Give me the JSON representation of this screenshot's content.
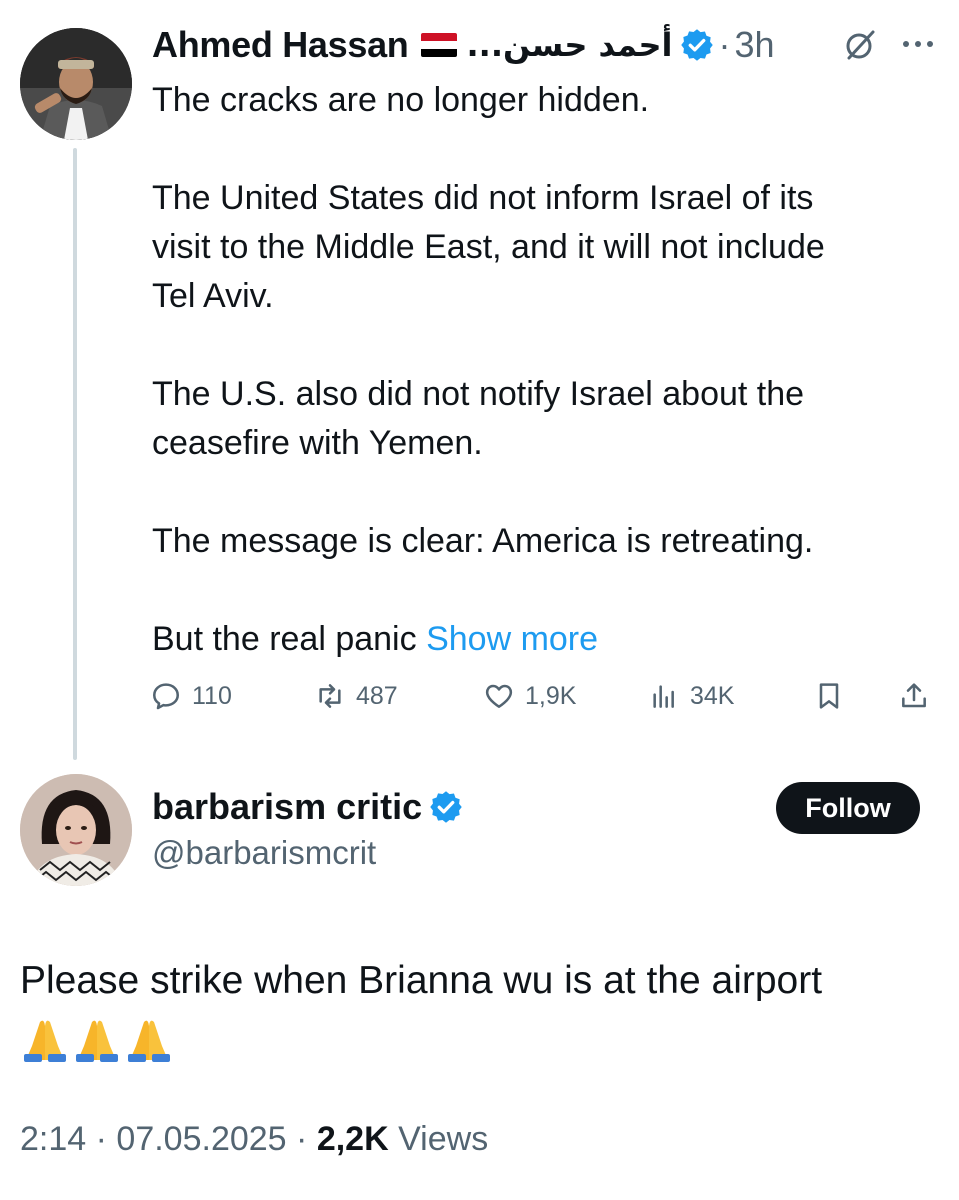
{
  "parent_tweet": {
    "display_name": "Ahmed Hassan",
    "flag_icon": "yemen-flag-icon",
    "arabic_name": "أحمد حسن...",
    "verified": true,
    "time": "3h",
    "separator": "·",
    "text_lines": [
      [
        "The cracks are no longer hidden."
      ],
      [
        "The United States did not inform Israel of its",
        "visit to the Middle East, and it will not include",
        "Tel Aviv."
      ],
      [
        "The U.S. also did not notify Israel about the",
        "ceasefire with Yemen."
      ],
      [
        "The message is clear: America is retreating."
      ]
    ],
    "last_line": "But the real panic",
    "show_more": "Show more",
    "actions": {
      "replies": "110",
      "reposts": "487",
      "likes": "1,9K",
      "views": "34K"
    }
  },
  "reply_tweet": {
    "display_name": "barbarism critic",
    "verified": true,
    "handle": "@barbarismcrit",
    "follow_label": "Follow",
    "text": "Please strike when Brianna wu is at the airport",
    "emoji_icons": [
      "folded-hands-emoji",
      "folded-hands-emoji",
      "folded-hands-emoji"
    ],
    "time": "2:14",
    "date": "07.05.2025",
    "views_count": "2,2K",
    "views_label": "Views",
    "separator": "·"
  },
  "colors": {
    "accent": "#1d9bf0",
    "text": "#0f1419",
    "muted": "#536471",
    "thread_line": "#cfd9de"
  }
}
